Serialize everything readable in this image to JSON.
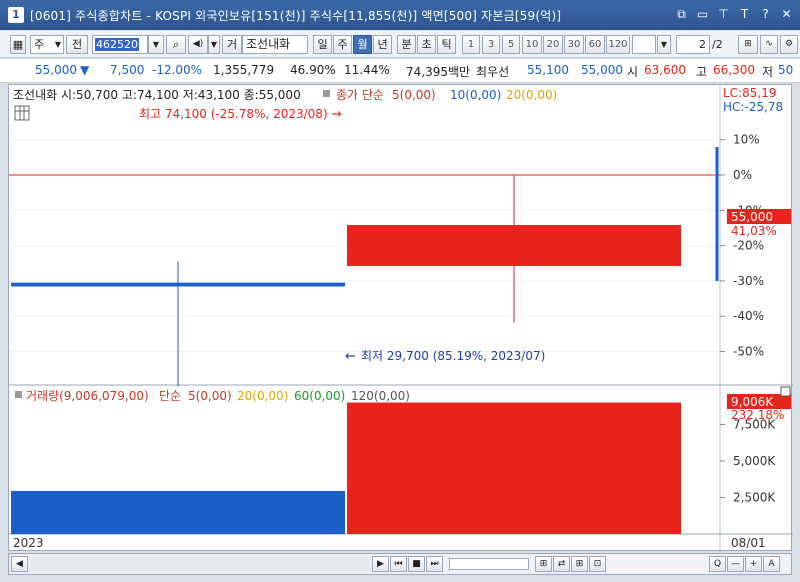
{
  "window": {
    "number": "1",
    "title": "[0601] 주식종합차트 - KOSPI 외국인보유[151(천)] 주식수[11,855(천)] 액면[500] 자본금[59(억)]",
    "buttons": [
      "⧉",
      "▭",
      "⊤",
      "T",
      "?",
      "✕"
    ]
  },
  "toolbar": {
    "market_select": "주",
    "all_btn": "전",
    "code": "462520",
    "search_icon": "⌕",
    "speaker_icon": "◀)",
    "ge_btn": "거",
    "stock_name": "조선내화",
    "periods": [
      "일",
      "주",
      "월",
      "년",
      "분",
      "초",
      "틱"
    ],
    "active_period": "월",
    "intervals": [
      "1",
      "3",
      "5",
      "10",
      "20",
      "30",
      "60",
      "120"
    ],
    "page": "2",
    "page_total": "/2"
  },
  "info": {
    "price": "55,000",
    "arrow": "▼",
    "change": "7,500",
    "change_pct": "-12.00%",
    "volume": "1,355,779",
    "ratio1": "46.90%",
    "ratio2": "11.44%",
    "amount": "74,395백만",
    "best_label": "최우선",
    "ask": "55,100",
    "bid": "55,000",
    "open_label": "시",
    "open": "63,600",
    "high_label": "고",
    "high": "66,300",
    "low_label": "저",
    "low": "50"
  },
  "price_panel": {
    "header": "조선내화 시:50,700 고:74,100 저:43,100 종:55,000",
    "ma_label": "종가 단순",
    "ma5": "5(0,00)",
    "ma10": "10(0,00)",
    "ma20": "20(0,00)",
    "max_note": "최고 74,100 (-25.78%, 2023/08)",
    "min_note": "최저 29,700 (85.19%, 2023/07)",
    "lc": "LC:85,19",
    "hc": "HC:-25,78",
    "current_price": "55,000",
    "current_pct": "41,03%",
    "axis_ticks": [
      "10%",
      "0%",
      "-10%",
      "-20%",
      "-30%",
      "-40%",
      "-50%"
    ]
  },
  "volume_panel": {
    "header": "거래량(9,006,079,00)",
    "ma_label": "단순",
    "ma5": "5(0,00)",
    "ma20": "20(0,00)",
    "ma60": "60(0,00)",
    "ma120": "120(0,00)",
    "current_vol": "9,006K",
    "current_pct": "232,18%",
    "axis_ticks": [
      "7,500K",
      "5,000K",
      "2,500K"
    ]
  },
  "x_axis": {
    "left_label": "2023",
    "right_label": "08/01"
  },
  "chart_data": {
    "type": "candlestick",
    "x": [
      "2023/07",
      "2023/08"
    ],
    "open": [
      50700,
      63600
    ],
    "high": [
      56000,
      74100
    ],
    "low": [
      29700,
      43100
    ],
    "close": [
      51500,
      55000
    ],
    "volume": [
      2950000,
      9006079
    ],
    "colors": {
      "up": "#e8231c",
      "down": "#1c5fc8"
    }
  },
  "bottom": {
    "buttons": [
      "◀",
      "▶",
      "⏮",
      "■",
      "⏭"
    ],
    "tools": [
      "⊞",
      "⇄",
      "⊞",
      "⊡",
      "Q",
      "—",
      "+",
      "A",
      "▶"
    ]
  }
}
